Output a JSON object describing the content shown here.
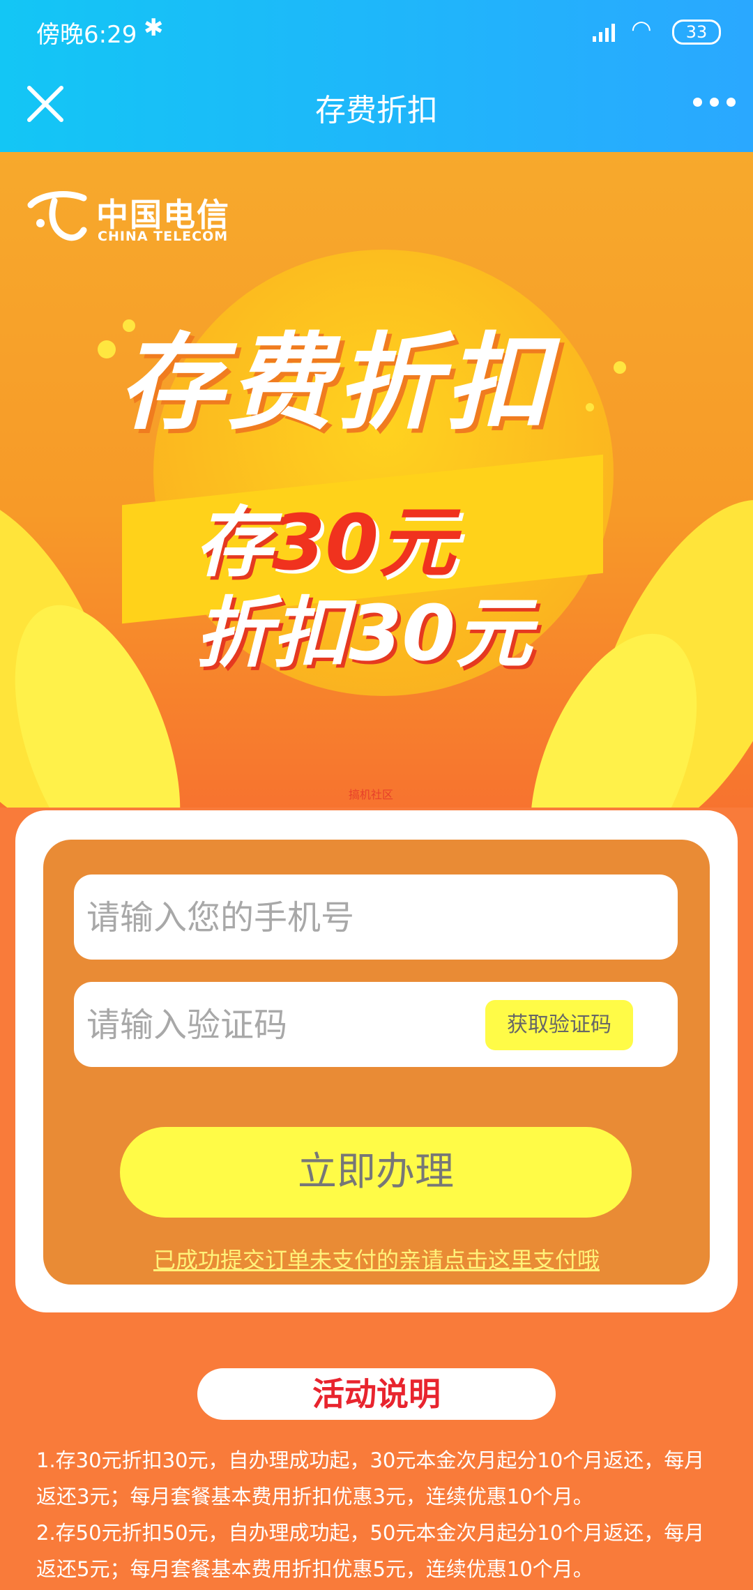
{
  "status_bar": {
    "time": "傍晚6:29",
    "battery": "33"
  },
  "header": {
    "title": "存费折扣"
  },
  "banner": {
    "logo_cn": "中国电信",
    "logo_en": "CHINA TELECOM",
    "headline": "存费折扣",
    "offer_line1_prefix": "存",
    "offer_line1_amount": "30元",
    "offer_line2": "折扣30元",
    "watermark": "搞机社区"
  },
  "form": {
    "phone_placeholder": "请输入您的手机号",
    "code_placeholder": "请输入验证码",
    "get_code_label": "获取验证码",
    "submit_label": "立即办理",
    "pay_link": "已成功提交订单未支付的亲请点击这里支付哦"
  },
  "description": {
    "title": "活动说明",
    "items": [
      "1.存30元折扣30元，自办理成功起，30元本金次月起分10个月返还，每月返还3元；每月套餐基本费用折扣优惠3元，连续优惠10个月。",
      "2.存50元折扣50元，自办理成功起，50元本金次月起分10个月返还，每月返还5元；每月套餐基本费用折扣优惠5元，连续优惠10个月。"
    ]
  },
  "colors": {
    "header": "#2aa8ff",
    "banner": "#f79a28",
    "form_inner": "#e98b35",
    "button": "#fffb47",
    "accent_red": "#e8242e"
  }
}
